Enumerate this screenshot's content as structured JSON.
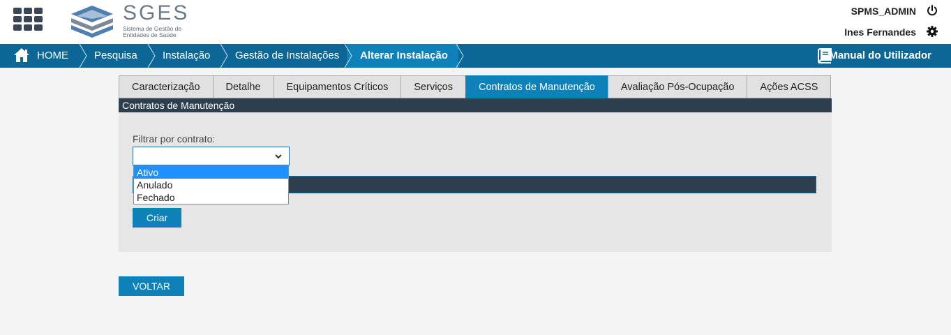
{
  "header": {
    "logo_name": "SGES",
    "logo_sub": "Sistema de Gestão de Entidades de Saúde",
    "user_role": "SPMS_ADMIN",
    "user_name": "Ines Fernandes",
    "icons": {
      "apps": "apps-grid-icon",
      "power": "power-icon",
      "settings": "gear-icon"
    }
  },
  "breadcrumb": {
    "items": [
      {
        "label": "HOME"
      },
      {
        "label": "Pesquisa"
      },
      {
        "label": "Instalação"
      },
      {
        "label": "Gestão de Instalações"
      },
      {
        "label": "Alterar Instalação"
      }
    ],
    "manual_label": "Manual do Utilizador"
  },
  "tabs": [
    {
      "label": "Caracterização"
    },
    {
      "label": "Detalhe"
    },
    {
      "label": "Equipamentos Críticos"
    },
    {
      "label": "Serviços"
    },
    {
      "label": "Contratos de Manutenção",
      "active": true
    },
    {
      "label": "Avaliação Pós-Ocupação"
    },
    {
      "label": "Ações ACSS"
    }
  ],
  "panel": {
    "title": "Contratos de Manutenção",
    "filter_label": "Filtrar por contrato:",
    "select_value": "",
    "options": [
      {
        "label": "Ativo",
        "highlighted": true
      },
      {
        "label": "Anulado"
      },
      {
        "label": "Fechado"
      }
    ],
    "create_button": "Criar"
  },
  "back_button": "VOLTAR",
  "colors": {
    "primary": "#0e82b8",
    "nav_bar": "#0d6796",
    "dark_header": "#2d3e4e",
    "option_highlight": "#1e90ff"
  }
}
